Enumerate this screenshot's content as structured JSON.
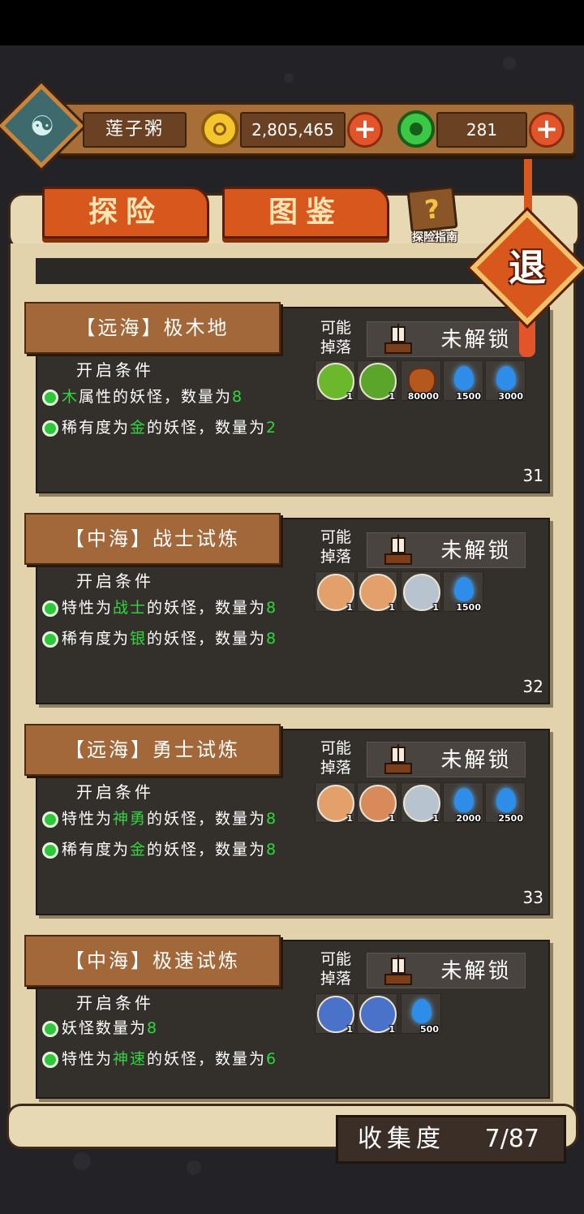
{
  "player": {
    "name": "莲子粥"
  },
  "currency": {
    "coins": "2,805,465",
    "jade": "281"
  },
  "tabs": [
    "探险",
    "图鉴"
  ],
  "guide_label": "探险指南",
  "exit_label": "退",
  "drop_label": "可能掉落",
  "stages": [
    {
      "title": "【远海】极木地",
      "cond_header": "开启条件",
      "lock_text": "未解锁",
      "conditions": [
        {
          "pre": "",
          "hl": "木",
          "post": "属性的妖怪，数量为",
          "num": "8"
        },
        {
          "pre": "稀有度为",
          "hl": "金",
          "post": "的妖怪，数量为",
          "num": "2"
        }
      ],
      "drops": [
        {
          "icon": "wood-monster-orb-icon",
          "count": "1"
        },
        {
          "icon": "wood-golem-orb-icon",
          "count": "1"
        },
        {
          "icon": "coin-bag-icon",
          "count": "80000"
        },
        {
          "icon": "blue-flame-icon",
          "count": "1500"
        },
        {
          "icon": "blue-flame-icon",
          "count": "3000"
        }
      ],
      "number": "31"
    },
    {
      "title": "【中海】战士试炼",
      "cond_header": "开启条件",
      "lock_text": "未解锁",
      "conditions": [
        {
          "pre": "特性为",
          "hl": "战士",
          "post": "的妖怪，数量为",
          "num": "8"
        },
        {
          "pre": "稀有度为",
          "hl": "银",
          "post": "的妖怪，数量为",
          "num": "8"
        }
      ],
      "drops": [
        {
          "icon": "warrior-badge-icon",
          "count": "1"
        },
        {
          "icon": "warrior-badge-icon",
          "count": "1"
        },
        {
          "icon": "blade-orb-icon",
          "count": "1"
        },
        {
          "icon": "blue-flame-icon",
          "count": "1500"
        }
      ],
      "number": "32"
    },
    {
      "title": "【远海】勇士试炼",
      "cond_header": "开启条件",
      "lock_text": "未解锁",
      "conditions": [
        {
          "pre": "特性为",
          "hl": "神勇",
          "post": "的妖怪，数量为",
          "num": "8"
        },
        {
          "pre": "稀有度为",
          "hl": "金",
          "post": "的妖怪，数量为",
          "num": "8"
        }
      ],
      "drops": [
        {
          "icon": "warrior-badge-icon",
          "count": "1"
        },
        {
          "icon": "brave-badge-icon",
          "count": "1"
        },
        {
          "icon": "blade-orb-icon",
          "count": "1"
        },
        {
          "icon": "blue-flame-icon",
          "count": "2000"
        },
        {
          "icon": "blue-flame-icon",
          "count": "2500"
        }
      ],
      "number": "33"
    },
    {
      "title": "【中海】极速试炼",
      "cond_header": "开启条件",
      "lock_text": "未解锁",
      "conditions": [
        {
          "pre": "妖怪数量为",
          "hl": "",
          "post": "",
          "num": "8"
        },
        {
          "pre": "特性为",
          "hl": "神速",
          "post": "的妖怪，数量为",
          "num": "6"
        }
      ],
      "drops": [
        {
          "icon": "speed-crystal-orb-icon",
          "count": "1"
        },
        {
          "icon": "speed-crystal-orb-icon",
          "count": "1"
        },
        {
          "icon": "blue-flame-icon",
          "count": "500"
        }
      ],
      "number": ""
    }
  ],
  "collection": {
    "label": "收集度",
    "value": "7/87"
  },
  "colors": {
    "accent_orange": "#d7571c",
    "highlight_green": "#2cd93a",
    "card_bg": "#33302c",
    "parchment": "#e3d3ac"
  }
}
